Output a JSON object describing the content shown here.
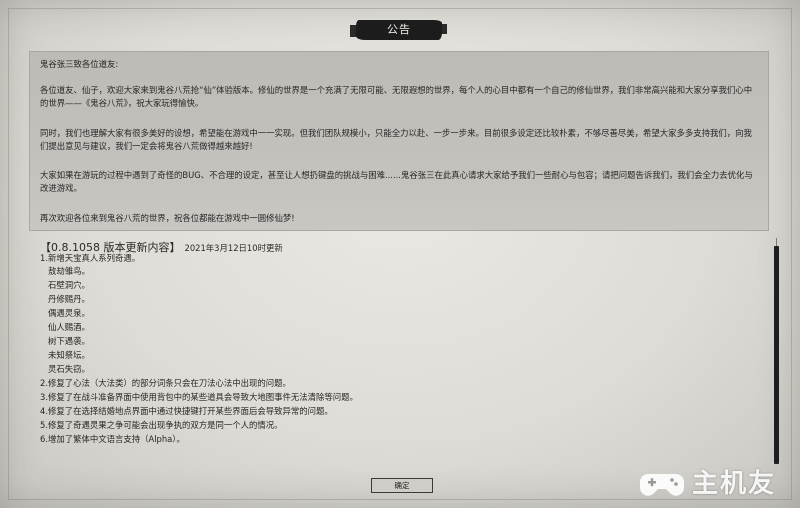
{
  "dialog": {
    "title": "公告",
    "ok_label": "确定"
  },
  "notice": {
    "greeting": "鬼谷张三致各位道友:",
    "paragraphs": [
      "各位道友、仙子，欢迎大家来到鬼谷八荒抢“仙”体验版本。修仙的世界是一个充满了无限可能、无限遐想的世界，每个人的心目中都有一个自己的修仙世界，我们非常高兴能和大家分享我们心中的世界——《鬼谷八荒》，祝大家玩得愉快。",
      "同时，我们也理解大家有很多美好的设想，希望能在游戏中一一实现。但我们团队规模小，只能全力以赴、一步一步来。目前很多设定还比较朴素，不够尽善尽美，希望大家多多支持我们，向我们提出意见与建议，我们一定会将鬼谷八荒做得越来越好!",
      "大家如果在游玩的过程中遇到了奇怪的BUG、不合理的设定，甚至让人想扔键盘的挑战与困难......鬼谷张三在此真心请求大家给予我们一些耐心与包容；请把问题告诉我们，我们会全力去优化与改进游戏。",
      "再次欢迎各位来到鬼谷八荒的世界，祝各位都能在游戏中一圆修仙梦!"
    ]
  },
  "update": {
    "title": "【0.8.1058 版本更新内容】",
    "date": "2021年3月12日10时更新",
    "items": [
      "1.新增天宝真人系列奇遇。",
      "敖劫雏鸟。",
      "石壁洞穴。",
      "丹修赐丹。",
      "偶遇灵泉。",
      "仙人赐酒。",
      "树下遇袭。",
      "未知祭坛。",
      "灵石失窃。",
      "2.修复了心法（大法类）的部分词条只会在刀法心法中出现的问题。",
      "3.修复了在战斗准备界面中使用背包中的某些道具会导致大地图事件无法清除等问题。",
      "4.修复了在选择结婚地点界面中通过快捷键打开某些界面后会导致异常的问题。",
      "5.修复了奇遇灵果之争可能会出现争执的双方是同一个人的情况。",
      "6.增加了繁体中文语言支持（Alpha）。"
    ]
  },
  "scrollbar": {
    "position": 0.0
  },
  "watermark": {
    "text": "主机友",
    "icon": "gamepad-icon"
  },
  "colors": {
    "title_bg": "#1c1c1c",
    "notice_bg": "#bdbbb6",
    "paper": "#e2e0da"
  }
}
